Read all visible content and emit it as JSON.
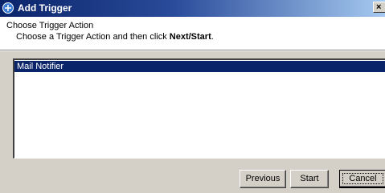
{
  "window": {
    "title": "Add Trigger",
    "icon": "app-icon",
    "close_glyph": "×"
  },
  "header": {
    "title": "Choose Trigger Action",
    "subtitle_prefix": "Choose a Trigger Action and then click ",
    "subtitle_bold": "Next/Start",
    "subtitle_suffix": "."
  },
  "actions": {
    "items": [
      {
        "label": "Mail Notifier",
        "selected": true
      }
    ]
  },
  "buttons": {
    "previous": "Previous",
    "start": "Start",
    "cancel": "Cancel"
  },
  "colors": {
    "titlebar": "#0a246a",
    "selection": "#0a246a",
    "face": "#d4d0c8"
  }
}
